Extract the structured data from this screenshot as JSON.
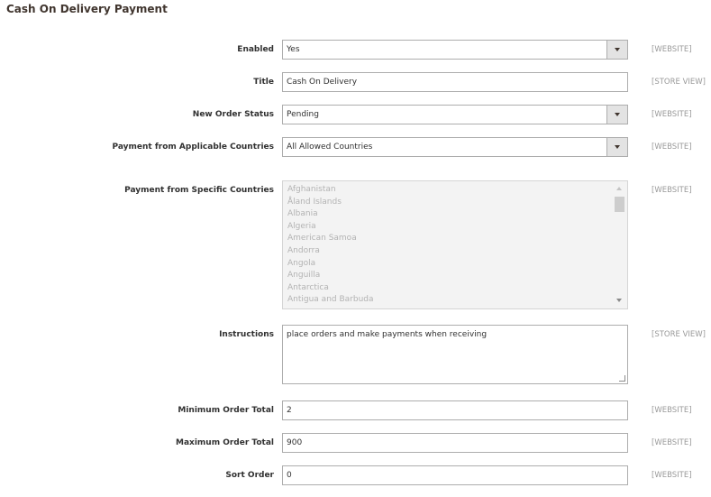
{
  "section": {
    "title": "Cash On Delivery Payment"
  },
  "fields": {
    "enabled": {
      "label": "Enabled",
      "value": "Yes",
      "scope": "[WEBSITE]"
    },
    "title": {
      "label": "Title",
      "value": "Cash On Delivery",
      "scope": "[STORE VIEW]"
    },
    "new_order_status": {
      "label": "New Order Status",
      "value": "Pending",
      "scope": "[WEBSITE]"
    },
    "applicable_countries": {
      "label": "Payment from Applicable Countries",
      "value": "All Allowed Countries",
      "scope": "[WEBSITE]"
    },
    "specific_countries": {
      "label": "Payment from Specific Countries",
      "scope": "[WEBSITE]",
      "options": [
        "Afghanistan",
        "Åland Islands",
        "Albania",
        "Algeria",
        "American Samoa",
        "Andorra",
        "Angola",
        "Anguilla",
        "Antarctica",
        "Antigua and Barbuda"
      ]
    },
    "instructions": {
      "label": "Instructions",
      "value": "place orders and make payments when receiving",
      "scope": "[STORE VIEW]"
    },
    "min_order_total": {
      "label": "Minimum Order Total",
      "value": "2",
      "scope": "[WEBSITE]"
    },
    "max_order_total": {
      "label": "Maximum Order Total",
      "value": "900",
      "scope": "[WEBSITE]"
    },
    "sort_order": {
      "label": "Sort Order",
      "value": "0",
      "scope": "[WEBSITE]"
    }
  }
}
